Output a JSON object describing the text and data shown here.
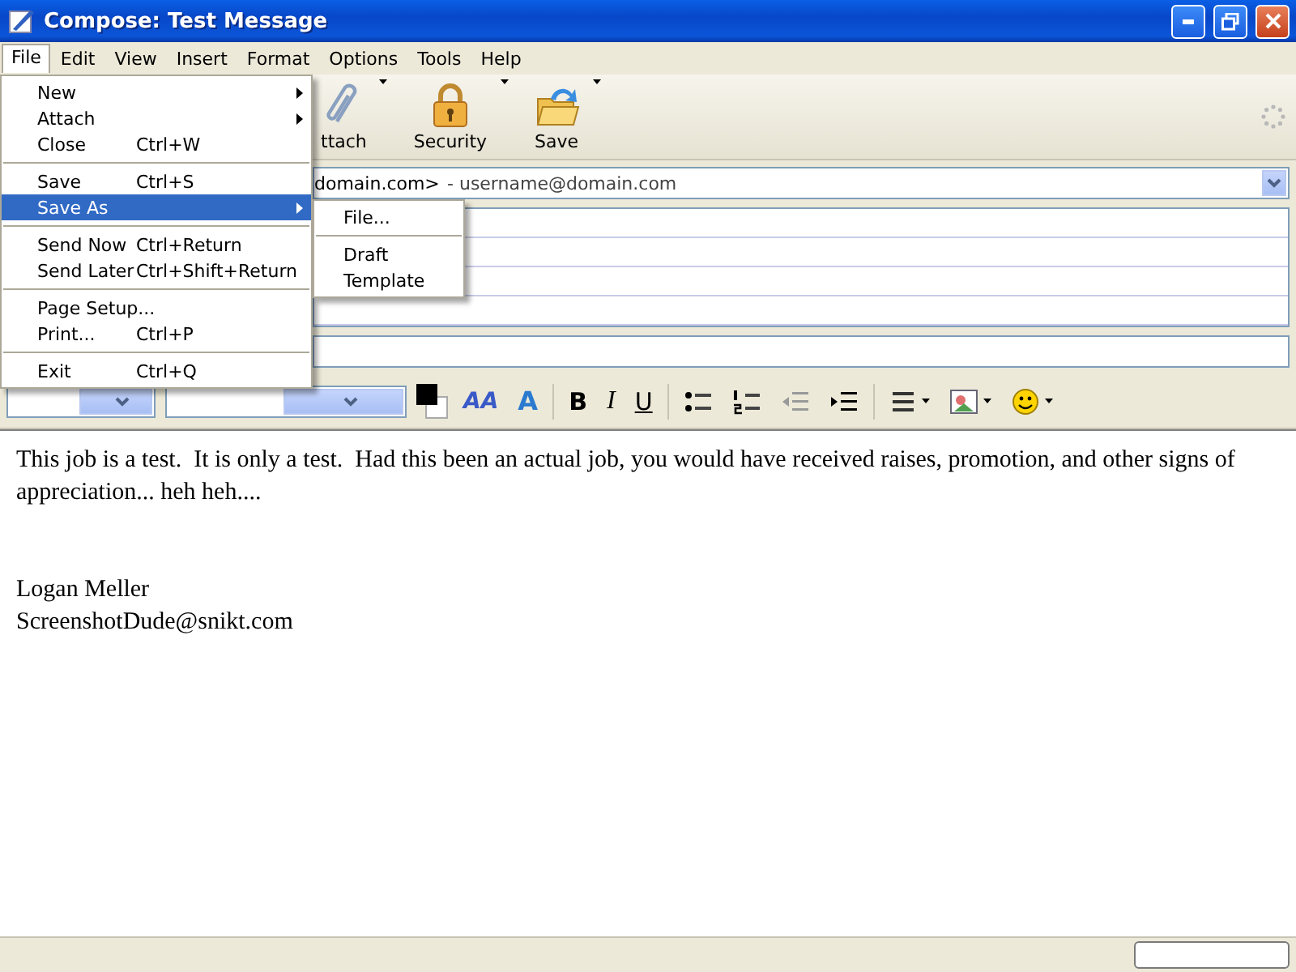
{
  "window": {
    "title": "Compose: Test Message"
  },
  "menubar": [
    {
      "label": "File",
      "selected": true
    },
    {
      "label": "Edit",
      "selected": false
    },
    {
      "label": "View",
      "selected": false
    },
    {
      "label": "Insert",
      "selected": false
    },
    {
      "label": "Format",
      "selected": false
    },
    {
      "label": "Options",
      "selected": false
    },
    {
      "label": "Tools",
      "selected": false
    },
    {
      "label": "Help",
      "selected": false
    }
  ],
  "toolbar": [
    {
      "label": "ttach"
    },
    {
      "label": "Security"
    },
    {
      "label": "Save"
    }
  ],
  "from": {
    "value": "domain.com>",
    "identity": "- username@domain.com"
  },
  "format_bar": {
    "smaller_text": "AA",
    "larger_text": "A",
    "bold": "B",
    "italic": "I",
    "underline": "U"
  },
  "body": {
    "text": "This job is a test.  It is only a test.  Had this been an actual job, you would have received raises, promotion, and other signs of appreciation... heh heh....",
    "signature": [
      "Logan Meller",
      "ScreenshotDude@snikt.com"
    ]
  },
  "file_menu": [
    {
      "kind": "item",
      "label": "New",
      "submenu": true,
      "selected": false
    },
    {
      "kind": "item",
      "label": "Attach",
      "submenu": true,
      "selected": false
    },
    {
      "kind": "item",
      "label": "Close",
      "shortcut": "Ctrl+W",
      "submenu": false,
      "selected": false
    },
    {
      "kind": "separator"
    },
    {
      "kind": "item",
      "label": "Save",
      "shortcut": "Ctrl+S",
      "submenu": false,
      "selected": false
    },
    {
      "kind": "item",
      "label": "Save As",
      "submenu": true,
      "selected": true
    },
    {
      "kind": "separator"
    },
    {
      "kind": "item",
      "label": "Send Now",
      "shortcut": "Ctrl+Return",
      "submenu": false,
      "selected": false
    },
    {
      "kind": "item",
      "label": "Send Later",
      "shortcut": "Ctrl+Shift+Return",
      "submenu": false,
      "selected": false
    },
    {
      "kind": "separator"
    },
    {
      "kind": "item",
      "label": "Page Setup...",
      "submenu": false,
      "selected": false
    },
    {
      "kind": "item",
      "label": "Print...",
      "shortcut": "Ctrl+P",
      "submenu": false,
      "selected": false
    },
    {
      "kind": "separator"
    },
    {
      "kind": "item",
      "label": "Exit",
      "shortcut": "Ctrl+Q",
      "submenu": false,
      "selected": false
    }
  ],
  "save_as_menu": [
    {
      "kind": "item",
      "label": "File...",
      "selected": false
    },
    {
      "kind": "separator"
    },
    {
      "kind": "item",
      "label": "Draft",
      "selected": false
    },
    {
      "kind": "item",
      "label": "Template",
      "selected": false
    }
  ]
}
